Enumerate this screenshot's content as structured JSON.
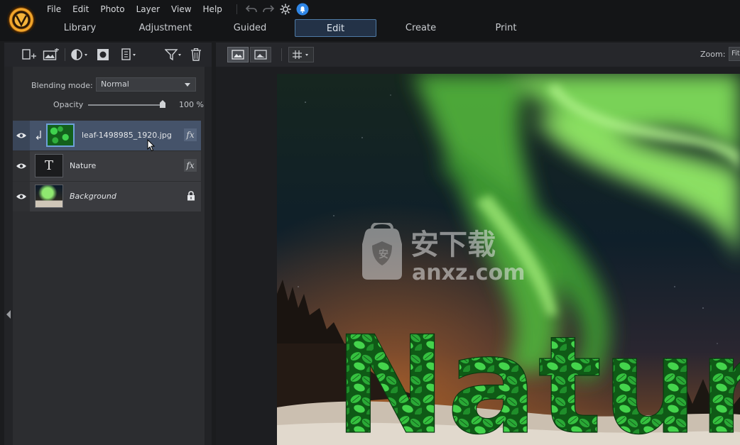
{
  "app": {
    "menu": [
      "File",
      "Edit",
      "Photo",
      "Layer",
      "View",
      "Help"
    ],
    "tabs": [
      "Library",
      "Adjustment",
      "Guided",
      "Edit",
      "Create",
      "Print"
    ],
    "active_tab": "Edit"
  },
  "layers_panel": {
    "blending_mode_label": "Blending mode:",
    "blending_mode_value": "Normal",
    "opacity_label": "Opacity",
    "opacity_value": "100 %",
    "opacity_fraction": 1.0,
    "layers": [
      {
        "name": "leaf-1498985_1920.jpg",
        "selected": true,
        "fx": true,
        "clipped": true,
        "thumb": "leaf"
      },
      {
        "name": "Nature",
        "selected": false,
        "fx": true,
        "thumb": "text"
      },
      {
        "name": "Background",
        "selected": false,
        "italic": true,
        "locked": true,
        "thumb": "aurora"
      }
    ]
  },
  "canvas": {
    "zoom_label": "Zoom:",
    "zoom_value": "Fit",
    "image_text": "Nature",
    "watermark_cn": "安下载",
    "watermark_en": "anxz.com"
  },
  "colors": {
    "accent": "#4f7ba6",
    "leaf_green": "#2bbf3a",
    "aurora_green": "#8ff06a",
    "sky": "#0c1826"
  }
}
